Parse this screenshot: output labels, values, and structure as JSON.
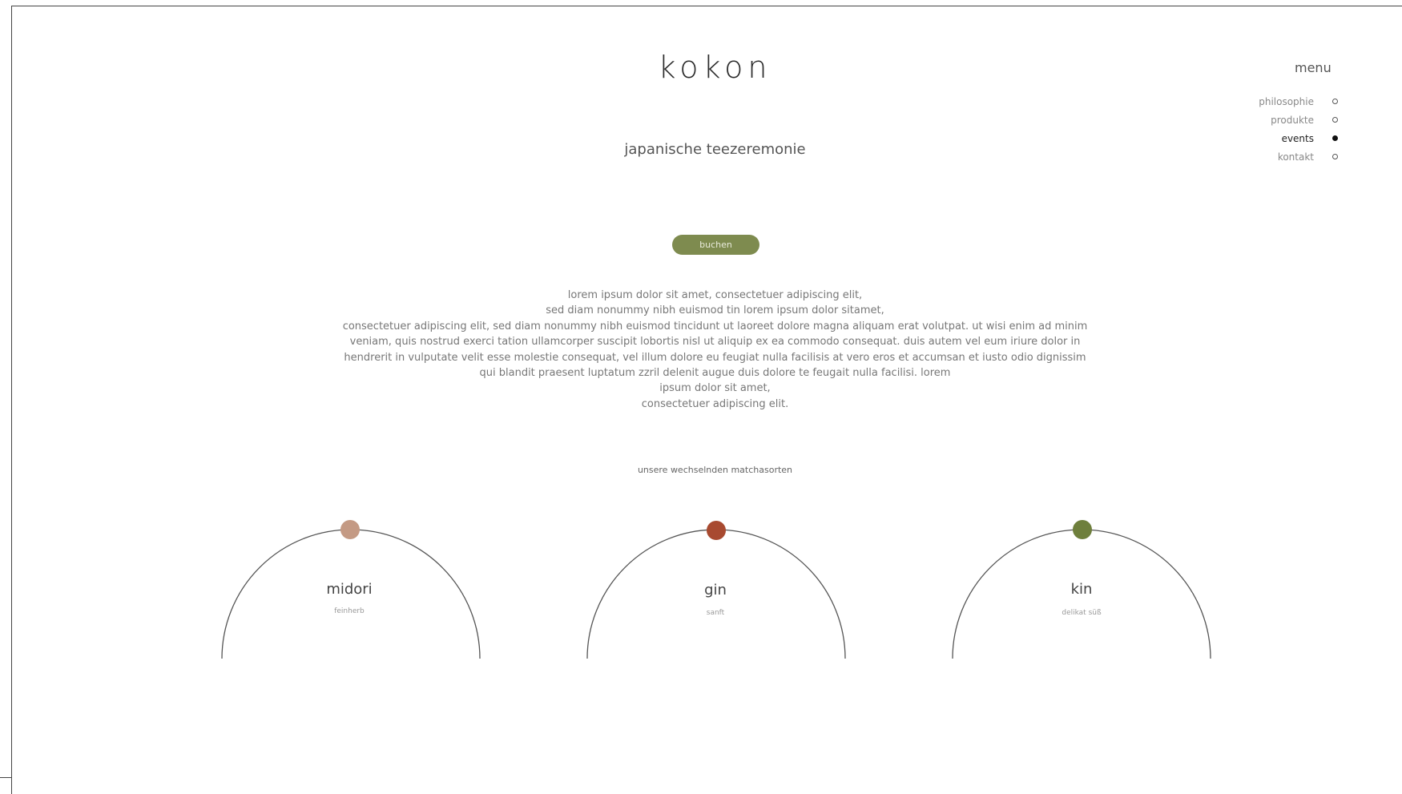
{
  "site": {
    "logo": "kokon",
    "subtitle": "japanische teezeremonie"
  },
  "menu": {
    "label": "menu",
    "items": [
      {
        "label": "philosophie",
        "active": false
      },
      {
        "label": "produkte",
        "active": false
      },
      {
        "label": "events",
        "active": true
      },
      {
        "label": "kontakt",
        "active": false
      }
    ]
  },
  "cta": {
    "book_label": "buchen"
  },
  "intro": {
    "lines": [
      "lorem ipsum dolor sit amet, consectetuer adipiscing elit,",
      "sed diam nonummy nibh euismod tin lorem ipsum dolor sitamet,",
      "consectetuer adipiscing elit, sed diam nonummy nibh euismod tincidunt ut laoreet dolore magna aliquam erat volutpat. ut wisi enim ad minim",
      "veniam, quis nostrud exerci tation ullamcorper suscipit lobortis nisl ut aliquip ex ea commodo consequat. duis autem vel eum iriure dolor in",
      "hendrerit in vulputate velit esse molestie consequat, vel illum dolore eu feugiat nulla facilisis at vero eros et accumsan et iusto odio dignissim",
      "qui blandit praesent luptatum zzril delenit augue duis dolore te feugait nulla facilisi. lorem",
      "ipsum dolor sit amet,",
      "consectetuer adipiscing elit."
    ]
  },
  "matcha": {
    "section_label": "unsere wechselnden matchasorten",
    "varieties": [
      {
        "name": "midori",
        "note": "feinherb",
        "color": "#c49a84"
      },
      {
        "name": "gin",
        "note": "sanft",
        "color": "#a84a30"
      },
      {
        "name": "kin",
        "note": "delikat süß",
        "color": "#6e7f3c"
      }
    ]
  },
  "colors": {
    "accent": "#7e8b4f",
    "text": "#555555",
    "line": "#555555"
  }
}
